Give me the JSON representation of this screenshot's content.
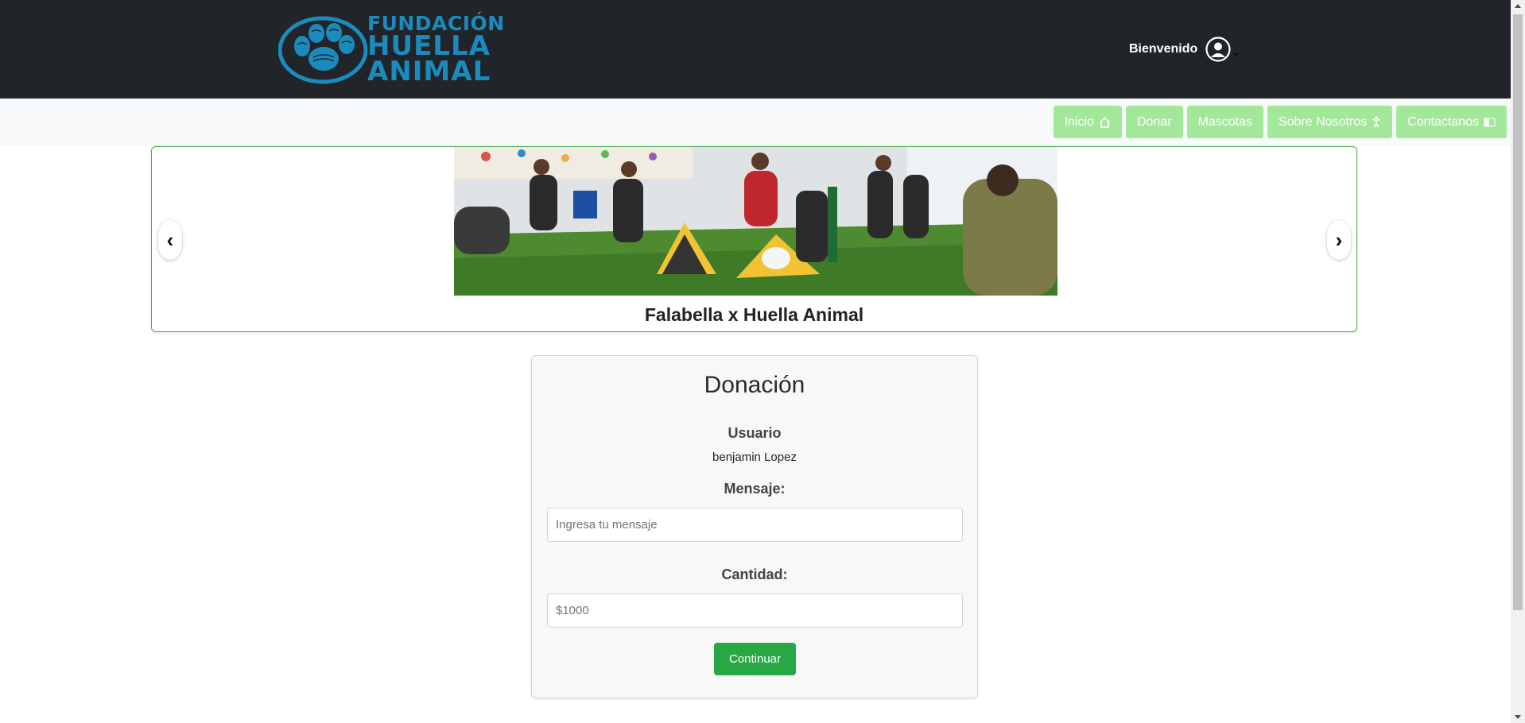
{
  "header": {
    "logo": {
      "line1": "FUNDACIÓN",
      "line2": "HUELLA",
      "line3": "ANIMAL",
      "icon": "paw-print-icon"
    },
    "greeting": "Bienvenido",
    "user_icon": "user-circle-icon"
  },
  "nav": {
    "items": [
      {
        "label": "Inicio",
        "icon": "home-icon"
      },
      {
        "label": "Donar",
        "icon": ""
      },
      {
        "label": "Mascotas",
        "icon": ""
      },
      {
        "label": "Sobre Nosotros",
        "icon": "person-icon"
      },
      {
        "label": "Contactanos",
        "icon": "book-icon"
      }
    ]
  },
  "carousel": {
    "caption": "Falabella x Huella Animal",
    "prev_icon": "chevron-left-icon",
    "next_icon": "chevron-right-icon",
    "prev_glyph": "‹",
    "next_glyph": "›"
  },
  "donation": {
    "title": "Donación",
    "user_label": "Usuario",
    "user_value": "benjamin Lopez",
    "message_label": "Mensaje:",
    "message_placeholder": "Ingresa tu mensaje",
    "amount_label": "Cantidad:",
    "amount_placeholder": "$1000",
    "submit_label": "Continuar"
  },
  "colors": {
    "header_bg": "#212529",
    "brand_blue": "#1b8bbd",
    "nav_button": "#a3e89a",
    "submit_green": "#28a745"
  }
}
